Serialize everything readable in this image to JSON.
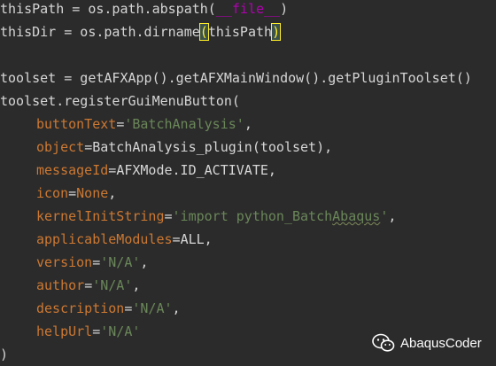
{
  "code": {
    "line1": {
      "a": "thisPath = os.path.abspath(",
      "b": "__file__",
      "c": ")"
    },
    "line2": {
      "a": "thisDir = os.path.dirname",
      "b": "(",
      "c": "thisPath",
      "d": ")"
    },
    "line4": "toolset = getAFXApp().getAFXMainWindow().getPluginToolset()",
    "line5": "toolset.registerGuiMenuButton(",
    "args": [
      {
        "name": "buttonText",
        "eq": "=",
        "value": "'BatchAnalysis'",
        "tail": ","
      },
      {
        "name": "object",
        "eq": "=",
        "value": "BatchAnalysis_plugin(toolset)",
        "tail": ","
      },
      {
        "name": "messageId",
        "eq": "=",
        "value": "AFXMode.ID_ACTIVATE",
        "tail": ","
      },
      {
        "name": "icon",
        "eq": "=",
        "value": "None",
        "tail": ","
      },
      {
        "name": "kernelInitString",
        "eq": "=",
        "value_a": "'import python_Batch",
        "value_b": "Abaqus",
        "value_c": "'",
        "tail": ","
      },
      {
        "name": "applicableModules",
        "eq": "=",
        "value": "ALL",
        "tail": ","
      },
      {
        "name": "version",
        "eq": "=",
        "value": "'N/A'",
        "tail": ","
      },
      {
        "name": "author",
        "eq": "=",
        "value": "'N/A'",
        "tail": ","
      },
      {
        "name": "description",
        "eq": "=",
        "value": "'N/A'",
        "tail": ","
      },
      {
        "name": "helpUrl",
        "eq": "=",
        "value": "'N/A'",
        "tail": ""
      }
    ],
    "close": ")"
  },
  "watermark": {
    "label": "AbaqusCoder",
    "icon": "wechat-icon"
  },
  "colors": {
    "background": "#2b2b2b",
    "default_text": "#d6d6d6",
    "keyword_arg": "#cc7832",
    "string": "#6a8759",
    "dunder": "#b200b2",
    "bracket_match": "#ffef28"
  }
}
